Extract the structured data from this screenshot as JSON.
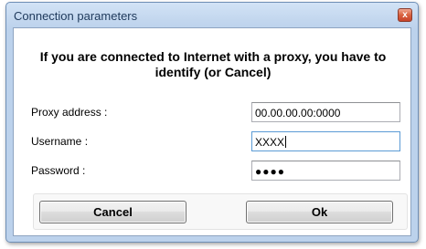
{
  "window": {
    "title": "Connection parameters",
    "close_glyph": "x",
    "close_icon": "close-icon"
  },
  "message": "If you are connected to Internet with a proxy, you have to identify (or Cancel)",
  "fields": {
    "proxy_address": {
      "label": "Proxy address :",
      "value": "00.00.00.00:0000"
    },
    "username": {
      "label": "Username :",
      "value": "XXXX"
    },
    "password": {
      "label": "Password :",
      "masked_value": "●●●●"
    }
  },
  "buttons": {
    "cancel_label": "Cancel",
    "ok_label": "Ok"
  },
  "colors": {
    "title_text": "#1e395b",
    "close_button": "#d9613f",
    "focus_border": "#5b9bd5"
  }
}
